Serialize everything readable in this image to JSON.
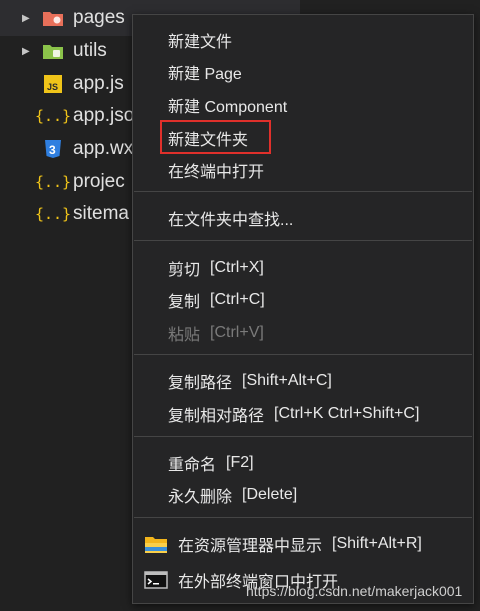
{
  "explorer": {
    "items": [
      {
        "label": "pages",
        "icon": "folder-pages-icon",
        "has_arrow": true
      },
      {
        "label": "utils",
        "icon": "folder-utils-icon",
        "has_arrow": true
      },
      {
        "label": "app.js",
        "icon": "js-file-icon",
        "has_arrow": false
      },
      {
        "label": "app.jso",
        "icon": "json-file-icon",
        "has_arrow": false
      },
      {
        "label": "app.wx",
        "icon": "css-file-icon",
        "has_arrow": false
      },
      {
        "label": "projec",
        "icon": "json-file-icon",
        "has_arrow": false
      },
      {
        "label": "sitema",
        "icon": "json-file-icon",
        "has_arrow": false
      }
    ],
    "icon_text": {
      "js": "JS",
      "json": "{..}",
      "css": "3"
    }
  },
  "menu": {
    "new_file": "新建文件",
    "new_page": "新建 Page",
    "new_component": "新建 Component",
    "new_folder": "新建文件夹",
    "open_in_terminal": "在终端中打开",
    "find_in_folder": "在文件夹中查找...",
    "cut": "剪切",
    "cut_shortcut": "[Ctrl+X]",
    "copy": "复制",
    "copy_shortcut": "[Ctrl+C]",
    "paste": "粘贴",
    "paste_shortcut": "[Ctrl+V]",
    "copy_path": "复制路径",
    "copy_path_shortcut": "[Shift+Alt+C]",
    "copy_relative_path": "复制相对路径",
    "copy_relative_path_shortcut": "[Ctrl+K Ctrl+Shift+C]",
    "rename": "重命名",
    "rename_shortcut": "[F2]",
    "delete": "永久删除",
    "delete_shortcut": "[Delete]",
    "reveal_in_explorer": "在资源管理器中显示",
    "reveal_in_explorer_shortcut": "[Shift+Alt+R]",
    "open_in_external_terminal": "在外部终端窗口中打开"
  },
  "watermark": "https://blog.csdn.net/makerjack001",
  "colors": {
    "highlight_border": "#e0302b",
    "folder_pages": "#e8705a",
    "folder_utils": "#8bc34a",
    "js": "#f0c419",
    "json": "#f0c419",
    "css": "#2f7fe0"
  }
}
